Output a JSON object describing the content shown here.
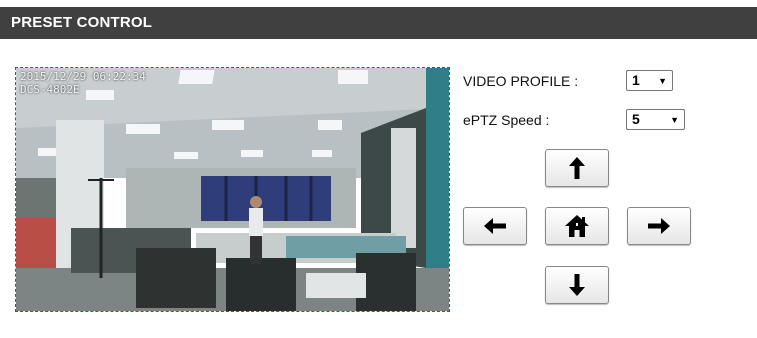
{
  "header": {
    "title": "PRESET CONTROL"
  },
  "video": {
    "timestamp": "2015/12/29 06:22:34",
    "camera": "DCS-4802E"
  },
  "profile": {
    "label": "VIDEO PROFILE  :",
    "value": "1"
  },
  "speed": {
    "label": "ePTZ Speed  :",
    "value": "5"
  },
  "controls": {
    "up": "arrow-up-icon",
    "down": "arrow-down-icon",
    "left": "arrow-left-icon",
    "right": "arrow-right-icon",
    "home": "home-icon"
  },
  "colors": {
    "header_bg": "#404040",
    "video_border": "#cc2222"
  }
}
